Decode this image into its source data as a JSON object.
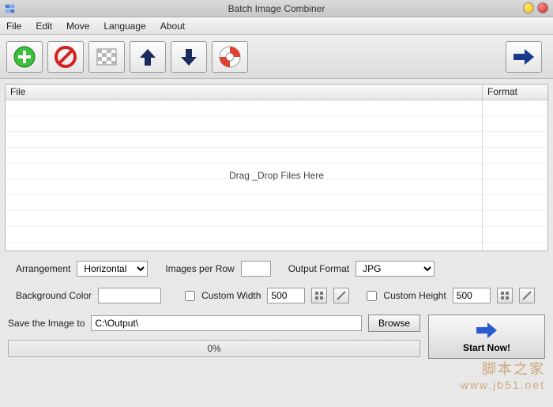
{
  "titlebar": {
    "title": "Batch Image Combiner"
  },
  "menu": {
    "file": "File",
    "edit": "Edit",
    "move": "Move",
    "language": "Language",
    "about": "About"
  },
  "toolbar": {
    "add": "add",
    "remove": "remove",
    "clear": "clear",
    "up": "move-up",
    "down": "move-down",
    "help": "help",
    "next": "next"
  },
  "grid": {
    "col_file": "File",
    "col_format": "Format",
    "empty_text": "Drag _Drop Files Here"
  },
  "opts": {
    "arrangement_label": "Arrangement",
    "arrangement_value": "Horizontal",
    "images_per_row_label": "Images per Row",
    "images_per_row_value": "",
    "output_format_label": "Output Format",
    "output_format_value": "JPG",
    "bgcolor_label": "Background Color",
    "bgcolor_value": "#ffffff",
    "custom_width_label": "Custom Width",
    "custom_width_value": "500",
    "custom_height_label": "Custom Height",
    "custom_height_value": "500"
  },
  "save": {
    "label": "Save the Image to",
    "path": "C:\\Output\\",
    "browse": "Browse",
    "progress_text": "0%",
    "start_label": "Start Now!"
  },
  "watermark": {
    "line1": "脚本之家",
    "line2": "www.jb51.net"
  }
}
